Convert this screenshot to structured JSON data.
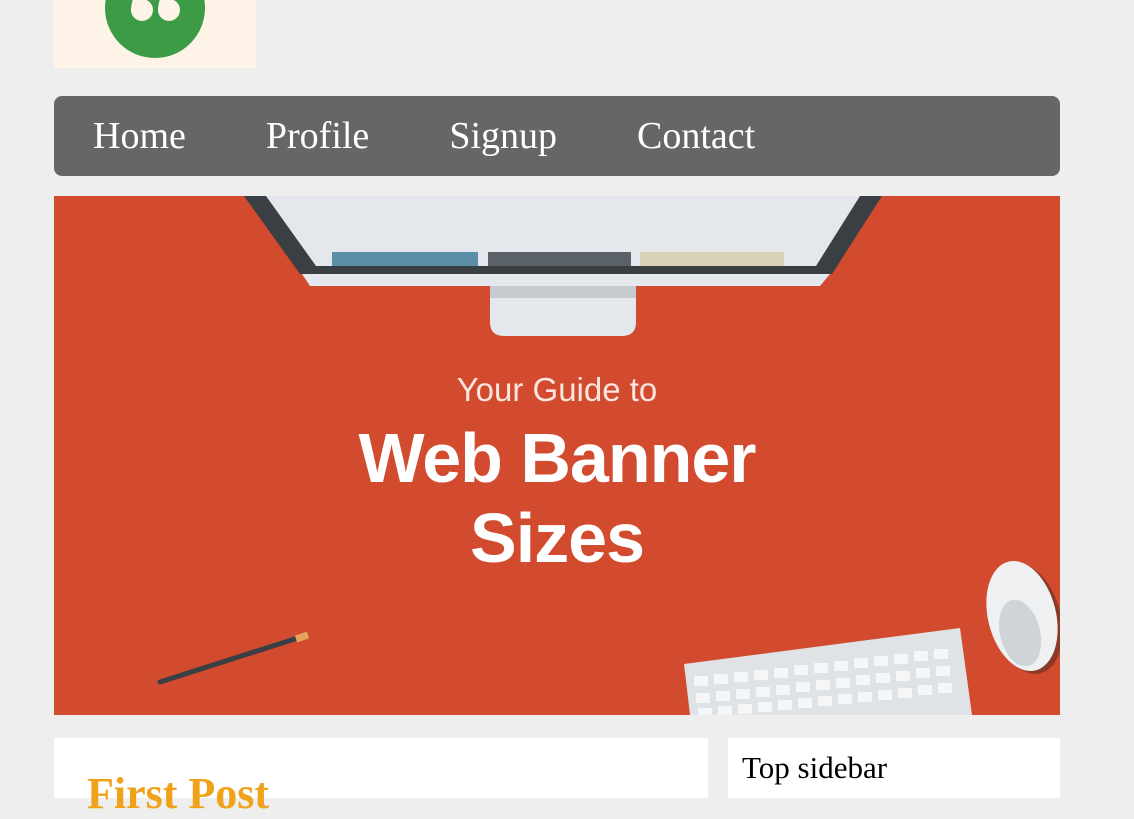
{
  "logo": {
    "icon": "quote-icon",
    "bg_color": "#fdf3e7",
    "circle_color": "#3e9b45"
  },
  "nav": {
    "items": [
      {
        "label": "Home"
      },
      {
        "label": "Profile"
      },
      {
        "label": "Signup"
      },
      {
        "label": "Contact"
      }
    ],
    "bg_color": "#666666"
  },
  "banner": {
    "subtitle": "Your Guide to",
    "title_line1": "Web Banner",
    "title_line2": "Sizes",
    "bg_color": "#d24b2f"
  },
  "main": {
    "post_title": "First Post"
  },
  "sidebar": {
    "title": "Top sidebar"
  }
}
